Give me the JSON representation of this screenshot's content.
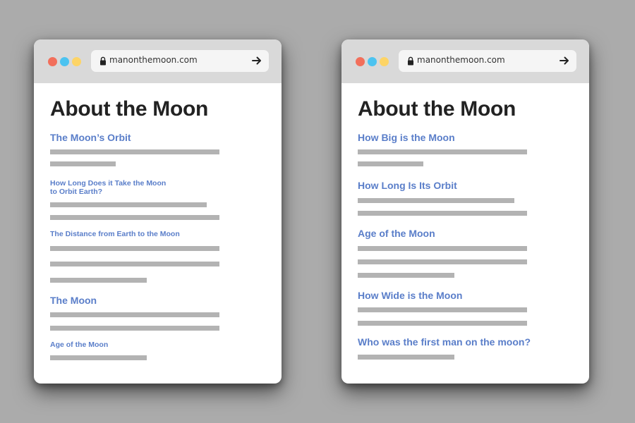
{
  "browsers": [
    {
      "id": "left",
      "url": "manonthemoon.com",
      "window_controls": [
        "close",
        "minimize",
        "maximize"
      ],
      "title": "About the Moon",
      "sections": [
        {
          "heading": "The Moon’s Orbit",
          "size": "large",
          "text_lines": [
            "full",
            "short"
          ]
        },
        {
          "heading": "How Long Does it Take the Moon\nto Orbit Earth?",
          "size": "small",
          "text_lines": [
            "long",
            "full"
          ]
        },
        {
          "heading": "The Distance from Earth to the Moon",
          "size": "small",
          "text_lines": [
            "full",
            "full",
            "half"
          ]
        },
        {
          "heading": "The Moon",
          "size": "large",
          "text_lines": [
            "full",
            "full"
          ]
        },
        {
          "heading": "Age of the Moon",
          "size": "small",
          "text_lines": [
            "half"
          ]
        }
      ]
    },
    {
      "id": "right",
      "url": "manonthemoon.com",
      "window_controls": [
        "close",
        "minimize",
        "maximize"
      ],
      "title": "About the Moon",
      "sections": [
        {
          "heading": "How Big is the Moon",
          "size": "large",
          "text_lines": [
            "full",
            "short"
          ]
        },
        {
          "heading": "How Long Is Its Orbit",
          "size": "large",
          "text_lines": [
            "long",
            "full"
          ]
        },
        {
          "heading": "Age of the Moon",
          "size": "large",
          "text_lines": [
            "full",
            "full",
            "half"
          ]
        },
        {
          "heading": "How Wide is the Moon",
          "size": "large",
          "text_lines": [
            "full",
            "full"
          ]
        },
        {
          "heading": "Who was the first man on the moon?",
          "size": "large",
          "text_lines": [
            "half"
          ]
        }
      ]
    }
  ],
  "icons": {
    "lock": "lock-icon",
    "go": "arrow-right-icon"
  },
  "colors": {
    "background": "#ababab",
    "chrome": "#d9d9d9",
    "heading": "#5a7ec9",
    "title": "#222222",
    "placeholder_line": "#b3b3b3",
    "dot_red": "#f26f5b",
    "dot_blue": "#4cc3f0",
    "dot_yellow": "#fdd466"
  }
}
